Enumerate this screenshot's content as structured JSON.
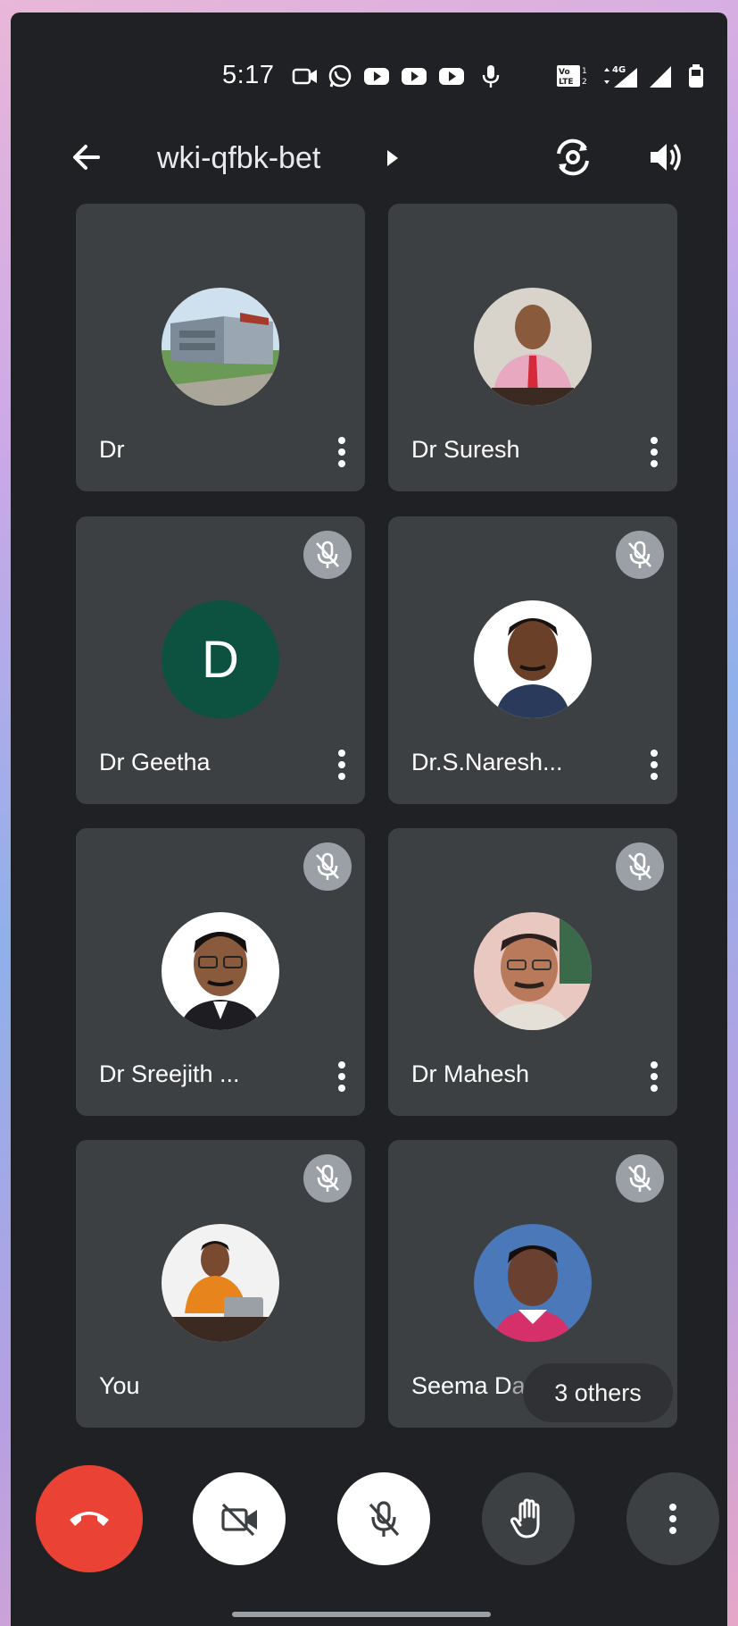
{
  "status_bar": {
    "time": "5:17",
    "icons": [
      "video-icon",
      "whatsapp-icon",
      "youtube-icon",
      "youtube-icon",
      "youtube-icon",
      "mic-icon",
      "volte-icon",
      "data-4g-icon",
      "signal-icon",
      "signal-icon",
      "battery-icon"
    ],
    "network_label": "4G"
  },
  "header": {
    "meeting_code": "wki-qfbk-bet"
  },
  "participants": [
    {
      "name": "Dr",
      "avatar": "photo-building",
      "muted": false
    },
    {
      "name": "Dr Suresh",
      "avatar": "photo-man-pink-shirt",
      "muted": false
    },
    {
      "name": "Dr Geetha",
      "avatar": "initial",
      "initial": "D",
      "avatar_color": "#0d5240",
      "muted": true
    },
    {
      "name": "Dr.S.Naresh...",
      "avatar": "photo-man-portrait",
      "muted": true
    },
    {
      "name": "Dr Sreejith ...",
      "avatar": "photo-man-glasses",
      "muted": true
    },
    {
      "name": "Dr Mahesh",
      "avatar": "photo-man-mustache",
      "muted": true
    },
    {
      "name": "You",
      "avatar": "photo-woman-laptop",
      "muted": true
    },
    {
      "name": "Seema D",
      "name_hidden_suffix": "a",
      "avatar": "photo-child",
      "muted": true
    }
  ],
  "others_chip": "3 others",
  "controls": {
    "end_call": "end-call-icon",
    "camera": "video-off-icon",
    "mic": "mic-off-icon",
    "hand": "raise-hand-icon",
    "more": "more-vert-icon"
  },
  "colors": {
    "background": "#202124",
    "tile": "#3c4043",
    "end_call": "#ea4335",
    "mute_badge": "#9aa0a6"
  }
}
